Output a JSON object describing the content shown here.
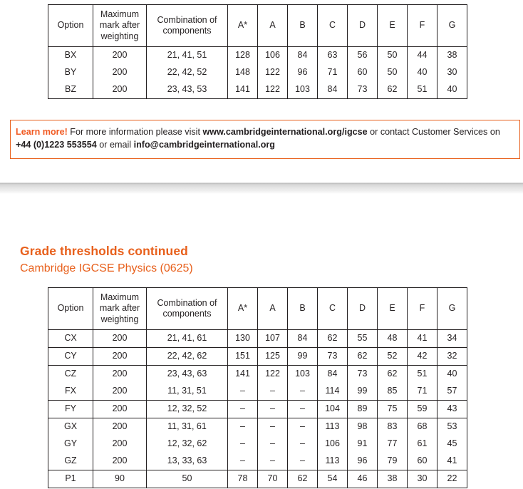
{
  "columns": [
    "Option",
    "Maximum mark after weighting",
    "Combination of components",
    "A*",
    "A",
    "B",
    "C",
    "D",
    "E",
    "F",
    "G"
  ],
  "table_top": {
    "headers": [
      "Option",
      "Maximum\nmark after\nweighting",
      "Combination of\ncomponents",
      "A*",
      "A",
      "B",
      "C",
      "D",
      "E",
      "F",
      "G"
    ],
    "rows": [
      {
        "option": "BX",
        "max": "200",
        "components": "21, 41, 51",
        "grades": [
          "128",
          "106",
          "84",
          "63",
          "56",
          "50",
          "44",
          "38"
        ]
      },
      {
        "option": "BY",
        "max": "200",
        "components": "22, 42, 52",
        "grades": [
          "148",
          "122",
          "96",
          "71",
          "60",
          "50",
          "40",
          "30"
        ]
      },
      {
        "option": "BZ",
        "max": "200",
        "components": "23, 43, 53",
        "grades": [
          "141",
          "122",
          "103",
          "84",
          "73",
          "62",
          "51",
          "40"
        ]
      }
    ]
  },
  "learn_more": {
    "lead": "Learn more!",
    "text_1": " For more information please visit ",
    "url": "www.cambridgeinternational.org/igcse",
    "text_2": " or contact Customer Services on ",
    "phone": "+44 (0)1223 553554",
    "text_3": " or email ",
    "email": "info@cambridgeinternational.org",
    "border_color": "#e8601c",
    "lead_color": "#f15a22"
  },
  "headings": {
    "main": "Grade thresholds continued",
    "sub": "Cambridge IGCSE Physics (0625)",
    "color": "#e8601c"
  },
  "table_bottom": {
    "headers": [
      "Option",
      "Maximum\nmark after\nweighting",
      "Combination of\ncomponents",
      "A*",
      "A",
      "B",
      "C",
      "D",
      "E",
      "F",
      "G"
    ],
    "rows": [
      {
        "option": "CX",
        "max": "200",
        "components": "21, 41, 61",
        "grades": [
          "130",
          "107",
          "84",
          "62",
          "55",
          "48",
          "41",
          "34"
        ]
      },
      {
        "option": "CY",
        "max": "200",
        "components": "22, 42, 62",
        "grades": [
          "151",
          "125",
          "99",
          "73",
          "62",
          "52",
          "42",
          "32"
        ]
      },
      {
        "option": "CZ",
        "max": "200",
        "components": "23, 43, 63",
        "grades": [
          "141",
          "122",
          "103",
          "84",
          "73",
          "62",
          "51",
          "40"
        ]
      },
      {
        "option": "FX",
        "max": "200",
        "components": "11, 31, 51",
        "grades": [
          "–",
          "–",
          "–",
          "114",
          "99",
          "85",
          "71",
          "57"
        ]
      },
      {
        "option": "FY",
        "max": "200",
        "components": "12, 32, 52",
        "grades": [
          "–",
          "–",
          "–",
          "104",
          "89",
          "75",
          "59",
          "43"
        ]
      },
      {
        "option": "GX",
        "max": "200",
        "components": "11, 31, 61",
        "grades": [
          "–",
          "–",
          "–",
          "113",
          "98",
          "83",
          "68",
          "53"
        ]
      },
      {
        "option": "GY",
        "max": "200",
        "components": "12, 32, 62",
        "grades": [
          "–",
          "–",
          "–",
          "106",
          "91",
          "77",
          "61",
          "45"
        ]
      },
      {
        "option": "GZ",
        "max": "200",
        "components": "13, 33, 63",
        "grades": [
          "–",
          "–",
          "–",
          "113",
          "96",
          "79",
          "60",
          "41"
        ]
      },
      {
        "option": "P1",
        "max": "90",
        "components": "50",
        "grades": [
          "78",
          "70",
          "62",
          "54",
          "46",
          "38",
          "30",
          "22"
        ]
      }
    ]
  }
}
